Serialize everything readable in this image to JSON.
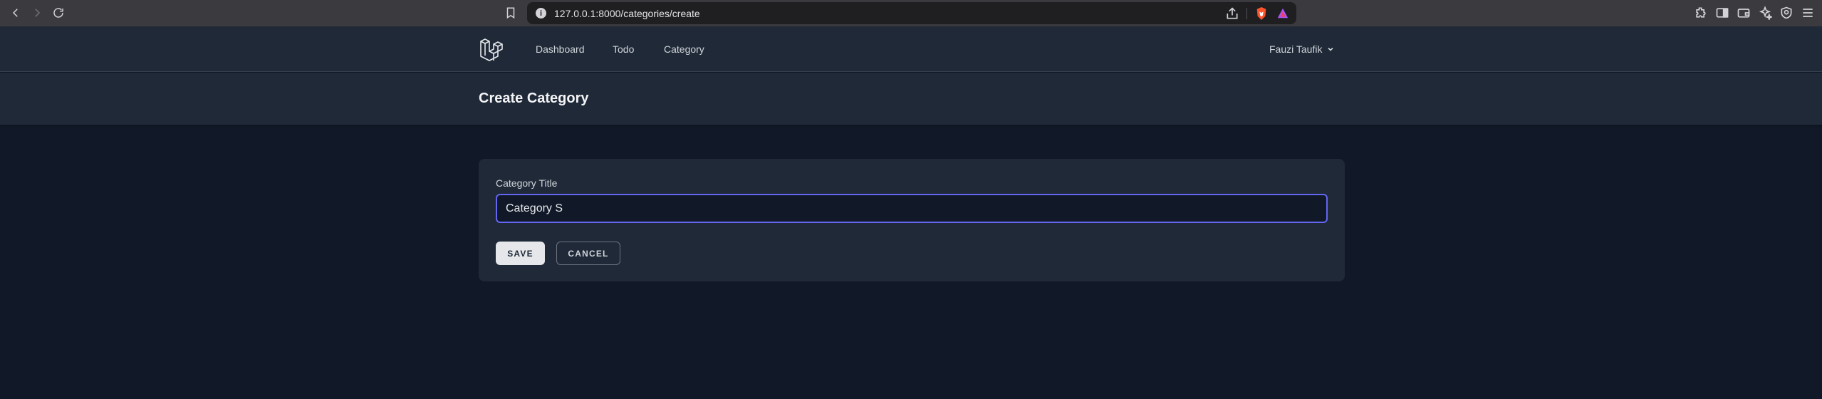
{
  "browser": {
    "url": "127.0.0.1:8000/categories/create"
  },
  "nav": {
    "links": [
      "Dashboard",
      "Todo",
      "Category"
    ],
    "user_name": "Fauzi Taufik"
  },
  "header": {
    "title": "Create Category"
  },
  "form": {
    "label": "Category Title",
    "value": "Category S",
    "save_label": "SAVE",
    "cancel_label": "CANCEL"
  },
  "colors": {
    "page_bg": "#111827",
    "panel_bg": "#1f2937",
    "focus_border": "#6366f1"
  },
  "icons": [
    "back-icon",
    "forward-icon",
    "reload-icon",
    "bookmark-icon",
    "info-icon",
    "share-icon",
    "brave-shield-icon",
    "brave-rewards-icon",
    "extensions-icon",
    "sidebar-icon",
    "wallet-icon",
    "leo-ai-icon",
    "vpn-icon",
    "menu-icon",
    "laravel-logo-icon",
    "chevron-down-icon"
  ]
}
